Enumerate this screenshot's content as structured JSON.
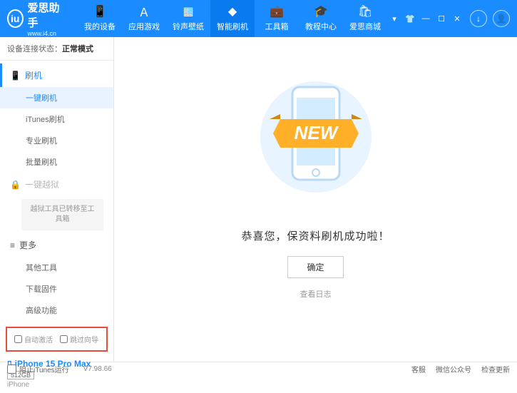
{
  "app": {
    "title": "爱思助手",
    "url": "www.i4.cn"
  },
  "nav": [
    {
      "label": "我的设备"
    },
    {
      "label": "应用游戏"
    },
    {
      "label": "铃声壁纸"
    },
    {
      "label": "智能刷机"
    },
    {
      "label": "工具箱"
    },
    {
      "label": "教程中心"
    },
    {
      "label": "爱思商城"
    }
  ],
  "status": {
    "label": "设备连接状态：",
    "value": "正常模式"
  },
  "sidebar": {
    "flash_head": "刷机",
    "flash_items": [
      "一键刷机",
      "iTunes刷机",
      "专业刷机",
      "批量刷机"
    ],
    "jailbreak_head": "一键越狱",
    "jailbreak_note": "越狱工具已转移至工具箱",
    "more_head": "更多",
    "more_items": [
      "其他工具",
      "下载固件",
      "高级功能"
    ]
  },
  "checks": {
    "auto_activate": "自动激活",
    "skip_guide": "跳过向导"
  },
  "device": {
    "name": "iPhone 15 Pro Max",
    "storage": "512GB",
    "type": "iPhone"
  },
  "main": {
    "badge": "NEW",
    "message": "恭喜您，保资料刷机成功啦！",
    "ok": "确定",
    "log": "查看日志"
  },
  "footer": {
    "block_itunes": "阻止iTunes运行",
    "version": "V7.98.66",
    "links": [
      "客服",
      "微信公众号",
      "检查更新"
    ]
  }
}
